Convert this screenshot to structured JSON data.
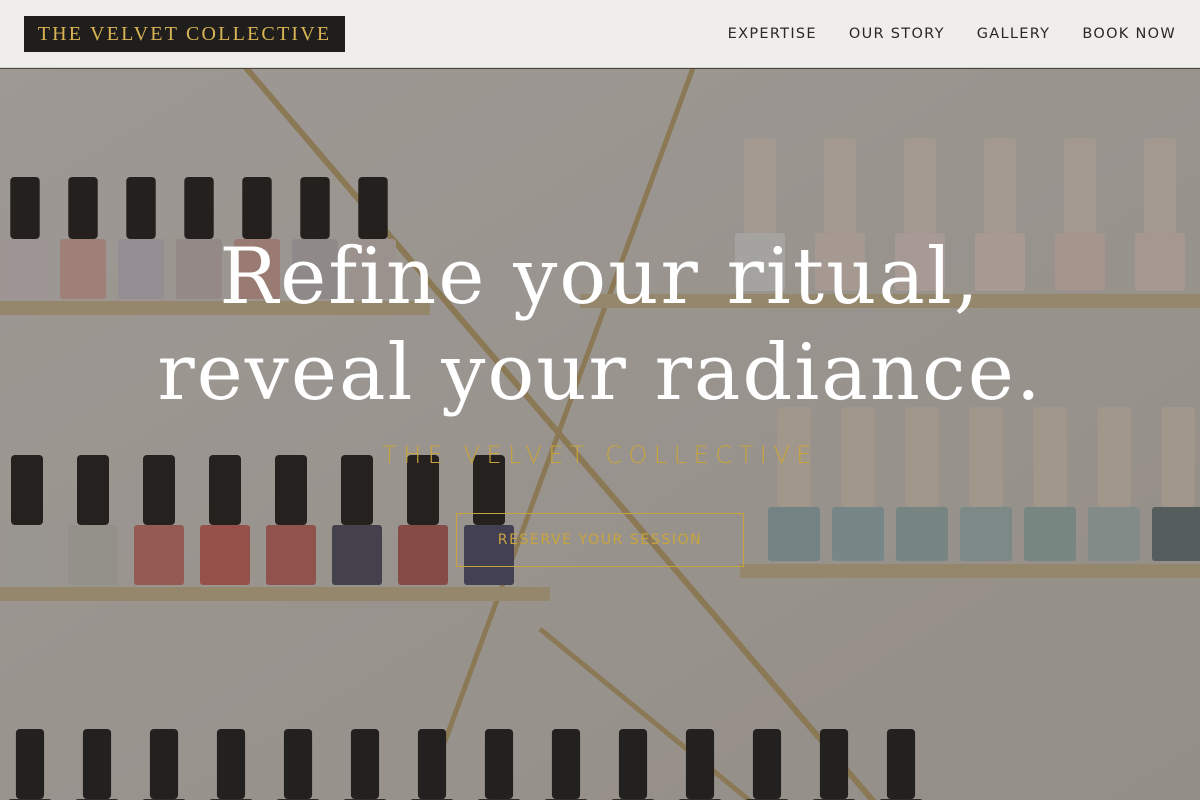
{
  "brand": {
    "logo_text": "THE VELVET COLLECTIVE",
    "accent": "#c9a43c"
  },
  "nav": {
    "items": [
      "EXPERTISE",
      "OUR STORY",
      "GALLERY",
      "BOOK NOW"
    ]
  },
  "hero": {
    "headline_line1": "Refine your ritual,",
    "headline_line2": "reveal your radiance.",
    "subtitle": "THE VELVET COLLECTIVE",
    "cta_label": "RESERVE YOUR SESSION",
    "background": "salon shelves with nail polish bottles"
  }
}
